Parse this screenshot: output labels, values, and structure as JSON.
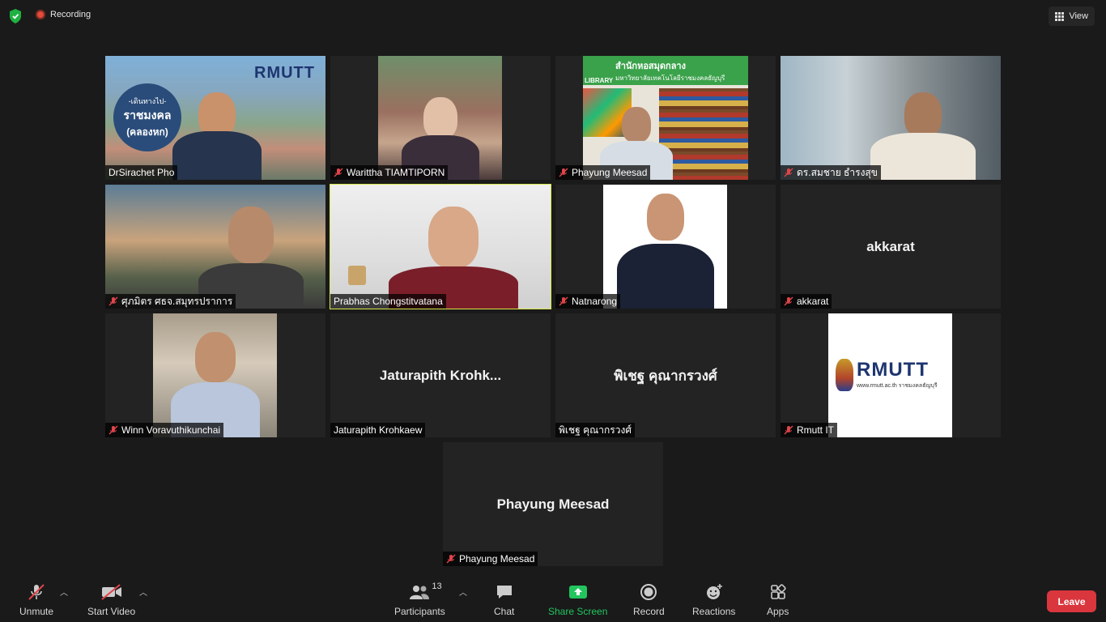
{
  "topbar": {
    "recording_label": "Recording",
    "view_label": "View"
  },
  "tiles": [
    {
      "name": "DrSirachet Pho",
      "muted": false,
      "overlay_text": [
        "RMUTT",
        "-เดินทางไป-",
        "ราชมงคล",
        "(คลองหก)"
      ]
    },
    {
      "name": "Warittha TIAMTIPORN",
      "muted": true
    },
    {
      "name": "Phayung Meesad",
      "muted": true,
      "overlay_text": [
        "LIBRARY",
        "สำนักหอสมุดกลาง",
        "มหาวิทยาลัยเทคโนโลยีราชมงคลธัญบุรี"
      ]
    },
    {
      "name": "ดร.สมชาย ธำรงสุข",
      "muted": true
    },
    {
      "name": "ศุภมิตร ศธจ.สมุทรปราการ",
      "muted": true
    },
    {
      "name": "Prabhas Chongstitvatana",
      "muted": false,
      "active": true
    },
    {
      "name": "Natnarong",
      "muted": true
    },
    {
      "name": "akkarat",
      "muted": true,
      "center": "akkarat"
    },
    {
      "name": "Winn Voravuthikunchai",
      "muted": true
    },
    {
      "name": "Jaturapith Krohkaew",
      "muted": false,
      "center": "Jaturapith  Krohk..."
    },
    {
      "name": "พิเชฐ  คุณากรวงศ์",
      "muted": false,
      "center": "พิเชฐ  คุณากรวงศ์"
    },
    {
      "name": "Rmutt IT",
      "muted": true,
      "overlay_text": [
        "RMUTT",
        "www.rmutt.ac.th",
        "ราชมงคลธัญบุรี"
      ]
    },
    {
      "name": "Phayung Meesad",
      "muted": true,
      "center": "Phayung Meesad"
    }
  ],
  "toolbar": {
    "unmute": "Unmute",
    "start_video": "Start Video",
    "participants": "Participants",
    "participants_count": "13",
    "chat": "Chat",
    "share_screen": "Share Screen",
    "record": "Record",
    "reactions": "Reactions",
    "apps": "Apps",
    "leave": "Leave"
  },
  "colors": {
    "background": "#1a1a1a",
    "tile": "#232323",
    "active_border": "#d7e84a",
    "share_green": "#22c55e",
    "leave_red": "#d9363e",
    "recording_red": "#e24b3b"
  }
}
